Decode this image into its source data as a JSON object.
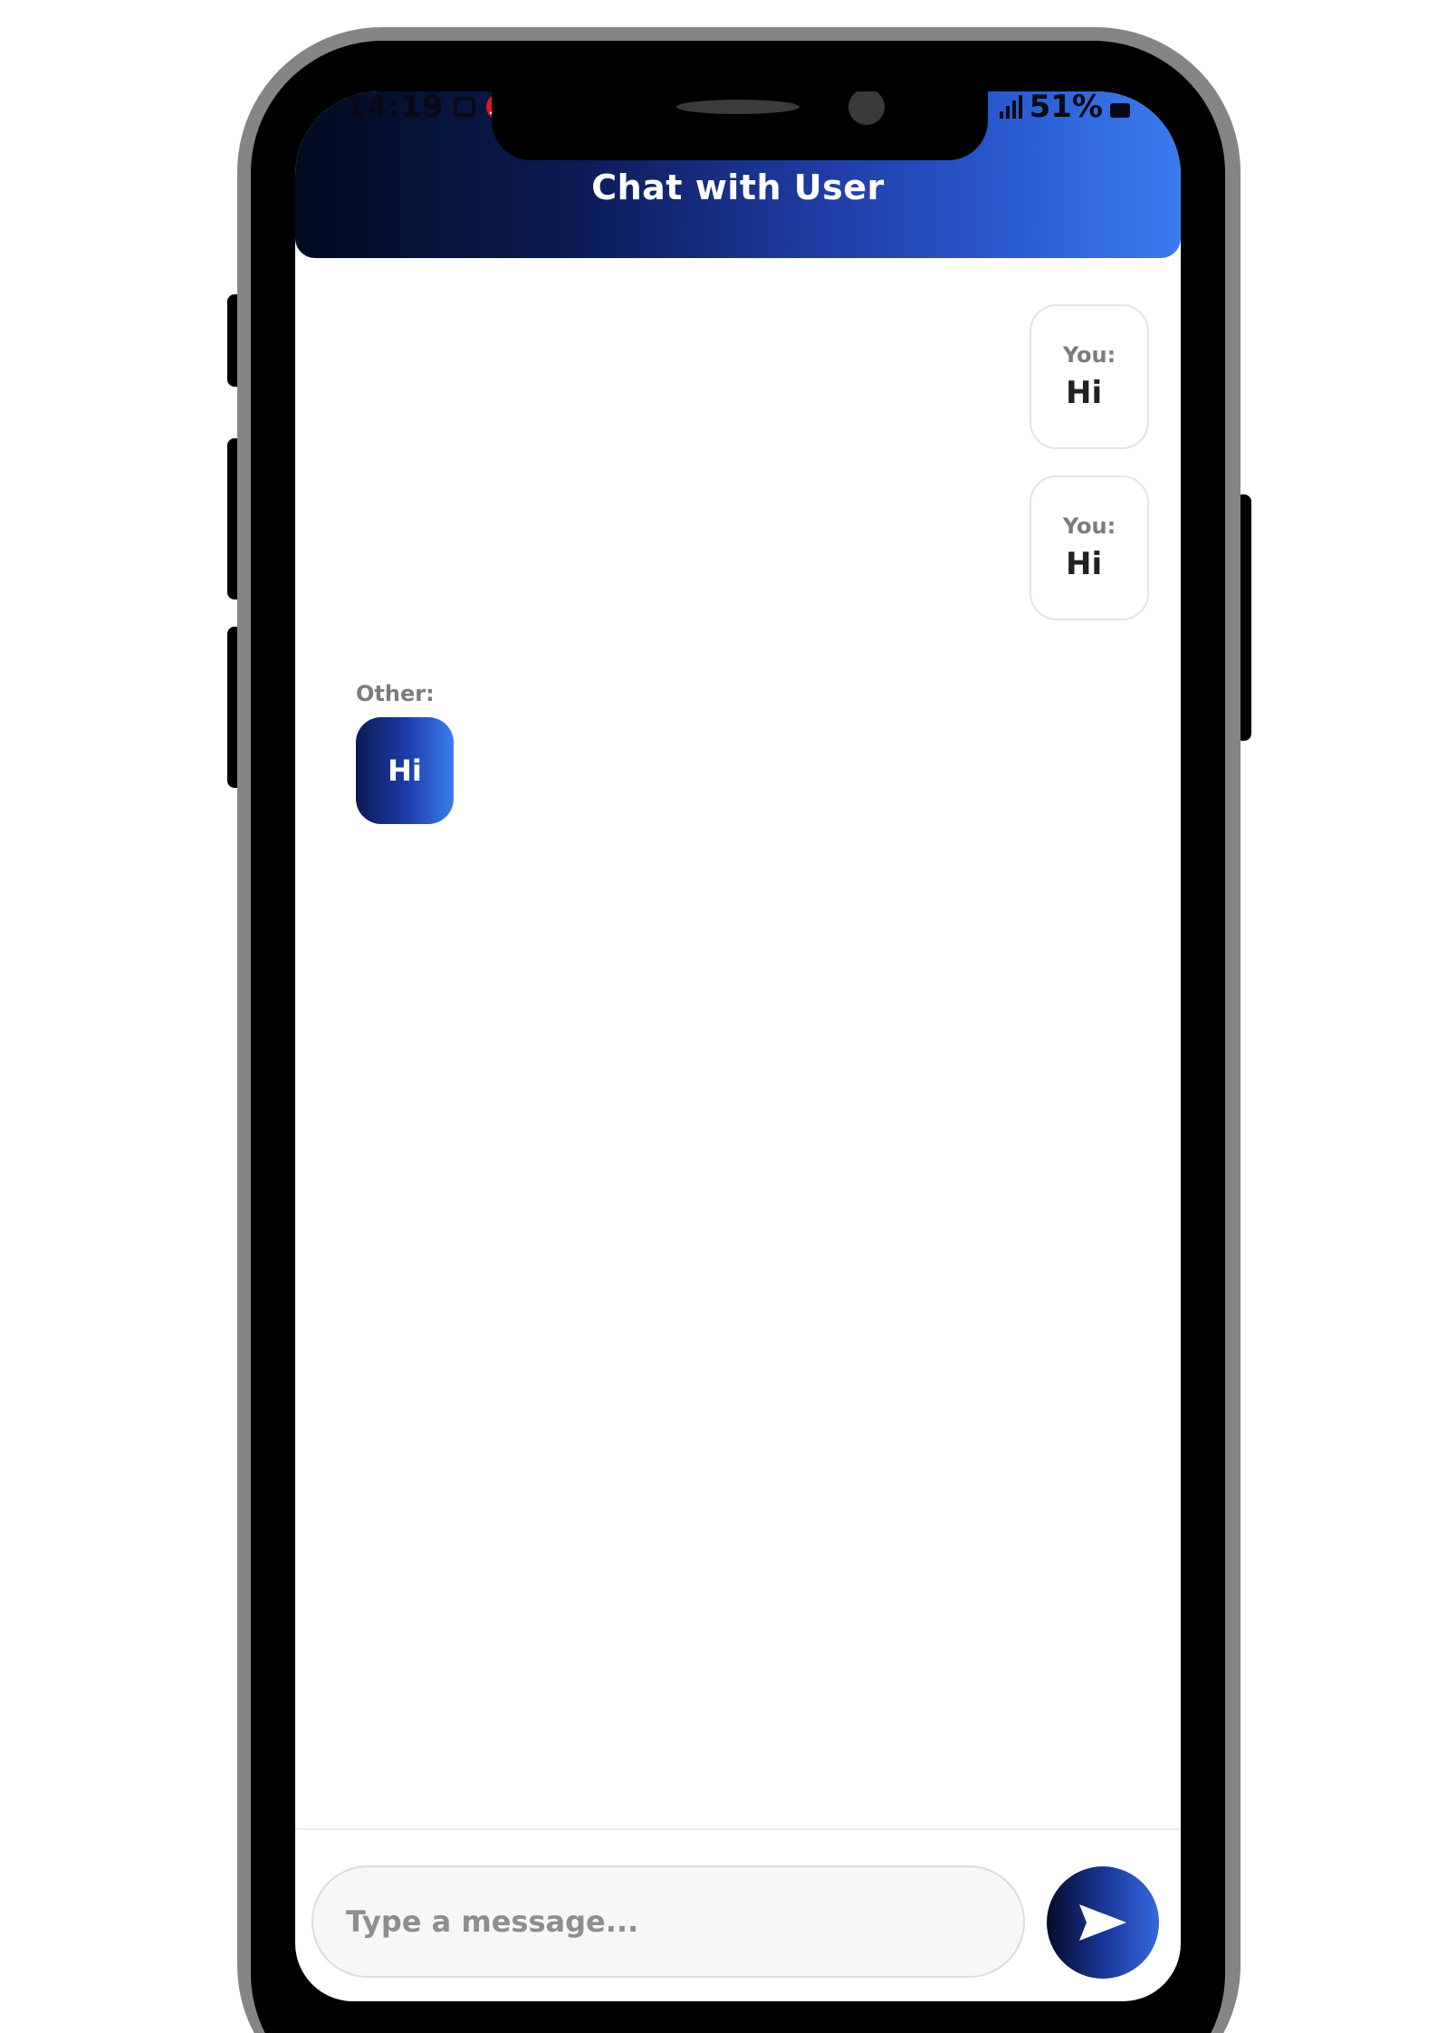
{
  "status_bar": {
    "time": "14:19",
    "carrier_badge": "Jio",
    "battery": "51%"
  },
  "header": {
    "title": "Chat with User"
  },
  "messages": [
    {
      "direction": "outgoing",
      "sender": "You:",
      "text": "Hi"
    },
    {
      "direction": "outgoing",
      "sender": "You:",
      "text": "Hi"
    },
    {
      "direction": "incoming",
      "sender": "Other:",
      "text": "Hi"
    }
  ],
  "composer": {
    "placeholder": "Type a message...",
    "value": "",
    "send_icon": "send-arrow-icon"
  },
  "colors": {
    "header_gradient_start": "#020b1f",
    "header_gradient_end": "#3b7cf0",
    "incoming_bubble_start": "#0b1b55",
    "incoming_bubble_end": "#3b7cf0",
    "frame": "#000000",
    "frame_rim": "#858585"
  }
}
